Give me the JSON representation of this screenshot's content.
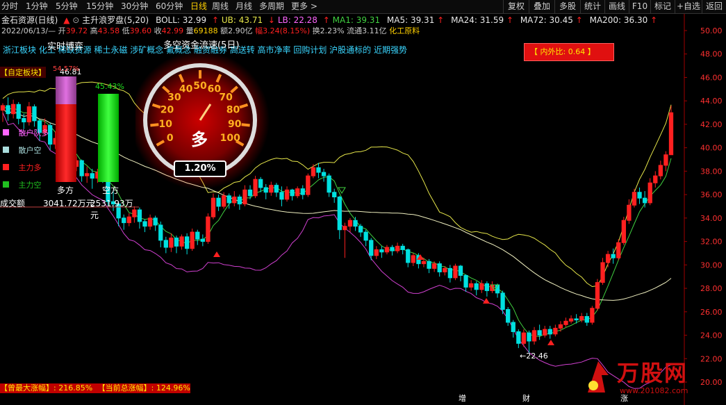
{
  "toolbar": {
    "timeframes": [
      "分时",
      "1分钟",
      "5分钟",
      "15分钟",
      "30分钟",
      "60分钟",
      "日线",
      "周线",
      "月线",
      "多周期",
      "更多 >"
    ],
    "active_timeframe": "日线",
    "right_buttons": [
      "复权",
      "叠加",
      "多股",
      "统计",
      "画线",
      "F10",
      "标记",
      "+自选",
      "返回"
    ]
  },
  "header": {
    "stock": "金石资源(日线)",
    "indicator": "主升浪罗盘(5,20)",
    "boll": "BOLL: 32.99",
    "ub": "UB: 43.71",
    "lb": "LB: 22.28",
    "ma1": "MA1: 39.31",
    "ma5": "MA5: 39.31",
    "ma24": "MA24: 31.59",
    "ma72": "MA72: 30.45",
    "ma200": "MA200: 36.30"
  },
  "quote": {
    "date": "2022/06/13/—",
    "open_label": "开",
    "open": "39.72",
    "high_label": "高",
    "high": "43.58",
    "low_label": "低",
    "low": "39.60",
    "close_label": "收",
    "close": "42.99",
    "vol_label": "量",
    "vol": "69188",
    "amount": "额2.90亿",
    "change": "幅3.24(8.15%)",
    "turnover": "换2.23%",
    "float": "流通3.11亿",
    "industry": "化工原料"
  },
  "concepts": "浙江板块 化工 稀缺资源 稀土永磁 涉矿概念 氟概念 融资融券 高送转 高市净率 回购计划 沪股通标的 近期强势",
  "overlay": {
    "title_realtime": "实时博弈",
    "title_flow": "多空资金流速(5日)",
    "custom_block": "【自定板块】",
    "legend": [
      "散户队多",
      "散户空",
      "主力多",
      "主力空"
    ],
    "legend_colors": [
      "#ff66ff",
      "#aadddd",
      "#ff2020",
      "#20c020"
    ],
    "long_label": "多方",
    "short_label": "空方",
    "bar_top_long": "54.57%",
    "bar_top_short": "45.43%",
    "high_label": "46.81",
    "volume_label": "成交额",
    "long_amount": "3041.72万元",
    "short_amount": "2531.93万元",
    "gauge_text": "多",
    "gauge_pct": "1.20%",
    "gauge_ticks": [
      "0",
      "10",
      "20",
      "30",
      "40",
      "50",
      "60",
      "70",
      "80",
      "90",
      "100"
    ]
  },
  "ratio_box": "【 内外比: 0.64 】",
  "axis": {
    "prices": [
      "50.00",
      "48.00",
      "46.00",
      "44.00",
      "42.00",
      "40.00",
      "38.00",
      "36.00",
      "34.00",
      "32.00",
      "30.00",
      "28.00",
      "26.00",
      "24.00",
      "22.00",
      "20.00"
    ]
  },
  "annotations": {
    "low_marker": "22.46",
    "bottom_markers": [
      "增",
      "财",
      "涨"
    ]
  },
  "bottom": {
    "max_gain": "【曾最大涨幅】: 216.85%",
    "total_gain": "【当前总涨幅】: 124.96%"
  },
  "watermark": {
    "name": "万股网",
    "url": "www.201082.com"
  },
  "colors": {
    "up": "#ff2020",
    "down": "#00e0e0",
    "ub": "#e6e64a",
    "lb": "#d040d0",
    "ma": "#40d040",
    "axis_text": "#ff3030"
  },
  "chart_data": {
    "type": "candlestick",
    "ylim": [
      20,
      50
    ],
    "candles": [
      [
        43.2,
        43.6,
        42.2,
        43.8
      ],
      [
        43.6,
        42.9,
        42.3,
        44.3
      ],
      [
        42.9,
        43.7,
        42.5,
        44.1
      ],
      [
        43.7,
        42.5,
        42.0,
        43.9
      ],
      [
        42.5,
        42.2,
        41.6,
        42.9
      ],
      [
        42.2,
        43.5,
        41.9,
        43.9
      ],
      [
        43.5,
        42.3,
        41.8,
        43.7
      ],
      [
        42.3,
        41.3,
        40.6,
        42.4
      ],
      [
        41.3,
        41.9,
        41.0,
        42.5
      ],
      [
        41.9,
        40.3,
        39.8,
        42.1
      ],
      [
        40.3,
        40.8,
        39.9,
        41.4
      ],
      [
        40.8,
        39.5,
        39.0,
        41.0
      ],
      [
        39.5,
        39.7,
        38.8,
        40.2
      ],
      [
        39.7,
        38.4,
        37.8,
        39.9
      ],
      [
        38.4,
        38.9,
        38.0,
        39.3
      ],
      [
        38.9,
        37.6,
        37.1,
        39.0
      ],
      [
        37.6,
        37.8,
        37.0,
        38.4
      ],
      [
        37.8,
        37.4,
        36.5,
        38.2
      ],
      [
        37.4,
        37.9,
        37.0,
        38.2
      ],
      [
        37.9,
        37.7,
        37.0,
        38.6
      ],
      [
        37.7,
        35.4,
        35.1,
        37.8
      ],
      [
        35.4,
        35.2,
        34.6,
        36.4
      ],
      [
        35.2,
        34.0,
        33.3,
        35.4
      ],
      [
        34.0,
        33.6,
        33.0,
        34.3
      ],
      [
        33.6,
        34.1,
        33.3,
        34.4
      ],
      [
        34.1,
        34.7,
        33.6,
        35.0
      ],
      [
        34.7,
        33.7,
        33.1,
        34.9
      ],
      [
        33.7,
        33.3,
        32.8,
        33.9
      ],
      [
        33.3,
        34.0,
        33.0,
        34.3
      ],
      [
        34.0,
        33.4,
        32.9,
        34.2
      ],
      [
        33.4,
        32.1,
        31.5,
        33.7
      ],
      [
        32.1,
        31.5,
        31.0,
        32.4
      ],
      [
        31.5,
        32.3,
        31.1,
        32.7
      ],
      [
        32.3,
        31.6,
        31.0,
        32.5
      ],
      [
        31.6,
        32.4,
        31.3,
        32.6
      ],
      [
        32.4,
        31.4,
        30.9,
        32.7
      ],
      [
        31.4,
        32.8,
        31.2,
        33.1
      ],
      [
        32.8,
        32.2,
        31.7,
        33.0
      ],
      [
        32.2,
        32.0,
        31.6,
        32.6
      ],
      [
        32.0,
        34.1,
        31.8,
        34.4
      ],
      [
        34.1,
        35.7,
        33.9,
        36.1
      ],
      [
        35.7,
        35.0,
        34.6,
        36.0
      ],
      [
        35.0,
        35.9,
        34.8,
        36.2
      ],
      [
        35.9,
        35.3,
        34.8,
        36.1
      ],
      [
        35.3,
        35.8,
        35.0,
        36.3
      ],
      [
        35.8,
        35.2,
        34.7,
        36.0
      ],
      [
        35.2,
        36.4,
        35.0,
        36.8
      ],
      [
        36.4,
        35.9,
        35.6,
        36.8
      ],
      [
        35.9,
        37.3,
        35.7,
        37.6
      ],
      [
        37.3,
        36.6,
        36.2,
        37.5
      ],
      [
        36.6,
        36.2,
        35.6,
        36.9
      ],
      [
        36.2,
        36.8,
        35.9,
        37.1
      ],
      [
        36.8,
        36.2,
        35.8,
        37.0
      ],
      [
        36.2,
        35.6,
        35.0,
        36.7
      ],
      [
        35.6,
        36.4,
        35.4,
        36.7
      ],
      [
        36.4,
        35.9,
        35.5,
        36.5
      ],
      [
        35.9,
        36.5,
        35.7,
        36.7
      ],
      [
        36.5,
        36.0,
        35.6,
        36.8
      ],
      [
        36.0,
        37.6,
        35.8,
        37.8
      ],
      [
        37.6,
        38.3,
        37.4,
        38.6
      ],
      [
        38.3,
        37.9,
        37.4,
        38.7
      ],
      [
        37.9,
        37.6,
        37.1,
        38.2
      ],
      [
        37.6,
        36.2,
        35.8,
        37.8
      ],
      [
        36.2,
        35.8,
        35.3,
        36.5
      ],
      [
        35.8,
        33.0,
        32.2,
        35.9
      ],
      [
        33.0,
        33.3,
        30.6,
        33.6
      ],
      [
        33.3,
        33.8,
        32.8,
        34.0
      ],
      [
        33.8,
        33.3,
        32.9,
        34.1
      ],
      [
        33.3,
        32.8,
        32.4,
        33.5
      ],
      [
        32.8,
        32.1,
        31.6,
        33.0
      ],
      [
        32.1,
        30.8,
        30.4,
        32.3
      ],
      [
        30.8,
        31.3,
        30.5,
        31.6
      ],
      [
        31.3,
        31.1,
        30.6,
        31.6
      ],
      [
        31.1,
        31.5,
        30.9,
        31.7
      ],
      [
        31.5,
        31.2,
        30.8,
        31.7
      ],
      [
        31.2,
        31.6,
        31.0,
        31.9
      ],
      [
        31.6,
        31.3,
        30.9,
        31.8
      ],
      [
        31.3,
        30.2,
        29.8,
        31.4
      ],
      [
        30.2,
        30.8,
        29.9,
        31.0
      ],
      [
        30.8,
        30.1,
        29.7,
        31.0
      ],
      [
        30.1,
        30.3,
        29.8,
        30.6
      ],
      [
        30.3,
        29.7,
        29.3,
        30.5
      ],
      [
        29.7,
        30.1,
        29.4,
        30.3
      ],
      [
        30.1,
        29.4,
        29.0,
        30.3
      ],
      [
        29.4,
        29.7,
        29.1,
        29.9
      ],
      [
        29.7,
        28.9,
        28.5,
        30.0
      ],
      [
        28.9,
        29.9,
        28.7,
        30.1
      ],
      [
        29.9,
        29.1,
        28.6,
        30.0
      ],
      [
        29.1,
        28.1,
        27.7,
        29.2
      ],
      [
        28.1,
        28.4,
        27.8,
        28.7
      ],
      [
        28.4,
        27.9,
        27.4,
        28.6
      ],
      [
        27.9,
        28.4,
        27.6,
        28.7
      ],
      [
        28.4,
        27.8,
        27.3,
        28.6
      ],
      [
        27.8,
        28.3,
        27.6,
        28.6
      ],
      [
        28.3,
        27.6,
        27.2,
        28.4
      ],
      [
        27.6,
        26.2,
        25.8,
        27.8
      ],
      [
        26.2,
        25.1,
        24.8,
        26.4
      ],
      [
        25.1,
        24.3,
        23.8,
        25.3
      ],
      [
        24.3,
        23.3,
        22.9,
        24.5
      ],
      [
        23.3,
        24.2,
        23.0,
        24.5
      ],
      [
        24.2,
        23.5,
        22.5,
        24.4
      ],
      [
        23.5,
        24.4,
        23.2,
        24.7
      ],
      [
        24.4,
        24.0,
        23.6,
        24.9
      ],
      [
        24.0,
        24.5,
        23.8,
        24.8
      ],
      [
        24.5,
        24.1,
        23.7,
        24.8
      ],
      [
        24.1,
        24.6,
        23.9,
        24.9
      ],
      [
        24.6,
        24.9,
        24.3,
        25.2
      ],
      [
        24.9,
        25.2,
        24.7,
        25.5
      ],
      [
        25.2,
        25.4,
        25.0,
        25.7
      ],
      [
        25.4,
        25.3,
        25.0,
        25.8
      ],
      [
        25.3,
        25.6,
        25.1,
        25.9
      ],
      [
        25.6,
        25.1,
        24.8,
        25.9
      ],
      [
        25.1,
        26.3,
        24.9,
        26.5
      ],
      [
        26.3,
        28.5,
        26.1,
        28.8
      ],
      [
        28.5,
        30.2,
        28.3,
        30.6
      ],
      [
        30.2,
        30.9,
        29.8,
        31.2
      ],
      [
        30.9,
        30.6,
        30.1,
        31.4
      ],
      [
        30.6,
        31.9,
        30.4,
        32.2
      ],
      [
        31.9,
        33.8,
        31.7,
        34.1
      ],
      [
        33.8,
        35.1,
        33.5,
        35.6
      ],
      [
        35.1,
        36.2,
        34.9,
        36.5
      ],
      [
        36.2,
        35.7,
        35.2,
        36.6
      ],
      [
        35.7,
        35.3,
        34.9,
        36.3
      ],
      [
        35.3,
        37.0,
        35.1,
        37.4
      ],
      [
        37.0,
        37.6,
        36.6,
        38.0
      ],
      [
        37.6,
        38.5,
        37.3,
        38.9
      ],
      [
        38.5,
        39.4,
        38.0,
        39.7
      ],
      [
        39.4,
        42.99,
        39.6,
        43.58
      ]
    ]
  }
}
